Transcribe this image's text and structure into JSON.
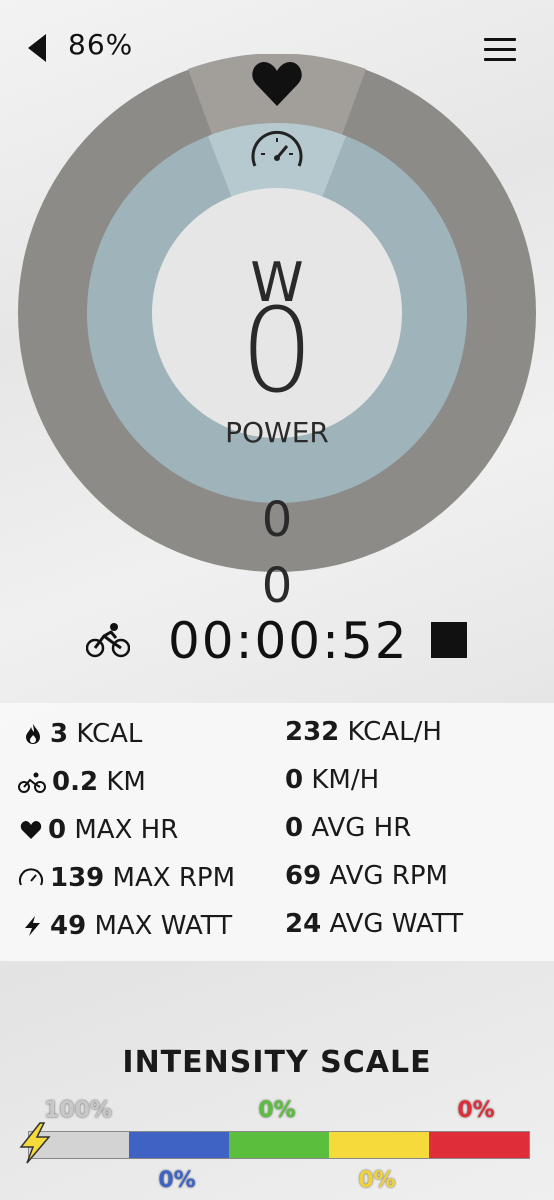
{
  "header": {
    "battery": "86%"
  },
  "gauge": {
    "unit": "W",
    "power_value": "0",
    "power_label": "POWER",
    "inner_value": "0",
    "outer_value": "0"
  },
  "timer": "00:00:52",
  "stats": {
    "left": [
      {
        "value": "3",
        "label": "KCAL",
        "icon": "flame-icon"
      },
      {
        "value": "0.2",
        "label": "KM",
        "icon": "bike-icon"
      },
      {
        "value": "0",
        "label": "MAX HR",
        "icon": "heart-icon"
      },
      {
        "value": "139",
        "label": "MAX RPM",
        "icon": "speedometer-icon"
      },
      {
        "value": "49",
        "label": "MAX WATT",
        "icon": "bolt-icon"
      }
    ],
    "right": [
      {
        "value": "232",
        "label": "KCAL/H"
      },
      {
        "value": "0",
        "label": "KM/H"
      },
      {
        "value": "0",
        "label": "AVG HR"
      },
      {
        "value": "69",
        "label": "AVG RPM"
      },
      {
        "value": "24",
        "label": "AVG WATT"
      }
    ]
  },
  "intensity": {
    "title": "INTENSITY SCALE",
    "zones": [
      {
        "pct": "100%",
        "color": "#d3d3d3",
        "label_color": "#c8c8c8"
      },
      {
        "pct": "0%",
        "color": "#3f63c5",
        "label_color": "#3f63c5"
      },
      {
        "pct": "0%",
        "color": "#5bbf3d",
        "label_color": "#5bbf3d"
      },
      {
        "pct": "0%",
        "color": "#f6d93b",
        "label_color": "#f2d23b"
      },
      {
        "pct": "0%",
        "color": "#df2e3a",
        "label_color": "#df2e3a"
      }
    ]
  },
  "colors": {
    "outer_ring": "#8d8b88",
    "inner_ring": "#9fb4ba",
    "center": "#e6e6e6"
  }
}
